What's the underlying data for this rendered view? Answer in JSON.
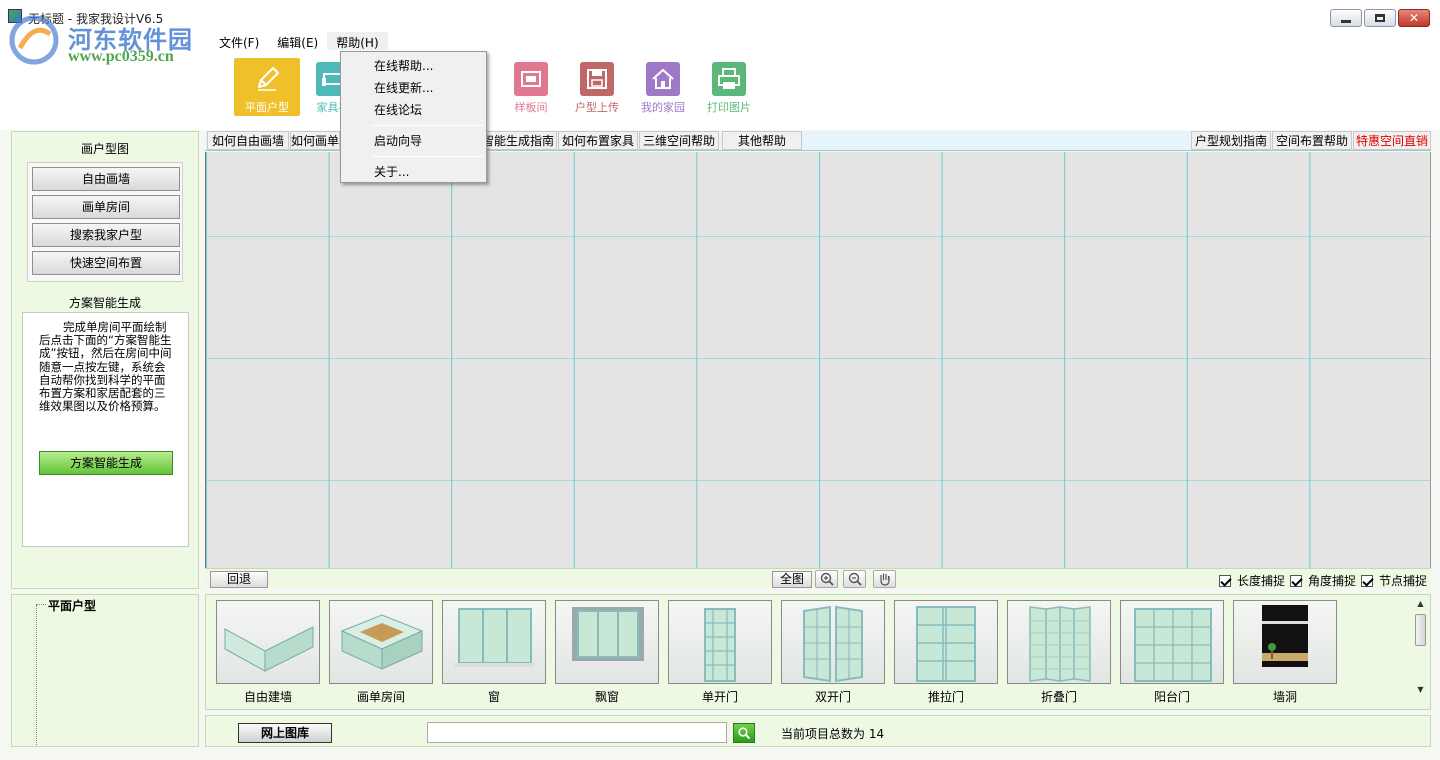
{
  "window": {
    "title": "无标题 - 我家我设计V6.5"
  },
  "watermark": {
    "site_name": "河东软件园",
    "url": "www.pc0359.cn"
  },
  "menubar": {
    "items": [
      {
        "label": "文件(F)"
      },
      {
        "label": "编辑(E)"
      },
      {
        "label": "帮助(H)"
      }
    ]
  },
  "toolbar": {
    "tools": [
      {
        "label": "平面户型",
        "icon": "pencil-icon",
        "color": "#f0c02a"
      },
      {
        "label": "家具布",
        "icon": "sofa-icon",
        "color": "#4fb8b8"
      },
      {
        "label": "样板间",
        "icon": "sample-room-icon",
        "color": "#e07890"
      },
      {
        "label": "户型上传",
        "icon": "floppy-disk-icon",
        "color": "#c06868"
      },
      {
        "label": "我的家园",
        "icon": "home-icon",
        "color": "#a078c8"
      },
      {
        "label": "打印图片",
        "icon": "printer-icon",
        "color": "#5cb87a"
      }
    ]
  },
  "help_menu": {
    "items": [
      "在线帮助...",
      "在线更新...",
      "在线论坛",
      "启动向导",
      "关于..."
    ]
  },
  "left_panel": {
    "title": "画户型图",
    "buttons": [
      "自由画墙",
      "画单房间",
      "搜索我家户型",
      "快速空间布置"
    ],
    "smart_title": "方案智能生成",
    "smart_desc": "完成单房间平面绘制后点击下面的“方案智能生成”按钮，然后在房间中间随意一点按左键，系统会自动帮你找到科学的平面布置方案和家居配套的三维效果图以及价格预算。",
    "smart_button": "方案智能生成"
  },
  "help_tabs": {
    "left": [
      "如何自由画墙",
      "如何画单",
      "智能生成指南",
      "如何布置家具",
      "三维空间帮助",
      "其他帮助"
    ],
    "right": [
      "户型规划指南",
      "空间布置帮助",
      "特惠空间直销"
    ],
    "hot_color": "#e00000"
  },
  "status_bar": {
    "undo": "回退",
    "full": "全图",
    "zoom_in_icon": "zoom-in-icon",
    "zoom_out_icon": "zoom-out-icon",
    "pan_icon": "hand-icon",
    "checks": [
      {
        "label": "长度捕捉",
        "checked": true
      },
      {
        "label": "角度捕捉",
        "checked": true
      },
      {
        "label": "节点捕捉",
        "checked": true
      }
    ]
  },
  "tree": {
    "root": "平面户型"
  },
  "gallery": {
    "items": [
      "自由建墙",
      "画单房间",
      "窗",
      "飘窗",
      "单开门",
      "双开门",
      "推拉门",
      "折叠门",
      "阳台门",
      "墙洞"
    ]
  },
  "bottom": {
    "library_button": "网上图库",
    "search_value": "",
    "search_placeholder": "",
    "count_label": "当前项目总数为",
    "count_value": "14"
  },
  "colors": {
    "panel_bg": "#eef9e4",
    "grid_line": "#68cccc",
    "canvas_bg": "#e4e4e4",
    "accent_green": "#62c23a"
  }
}
